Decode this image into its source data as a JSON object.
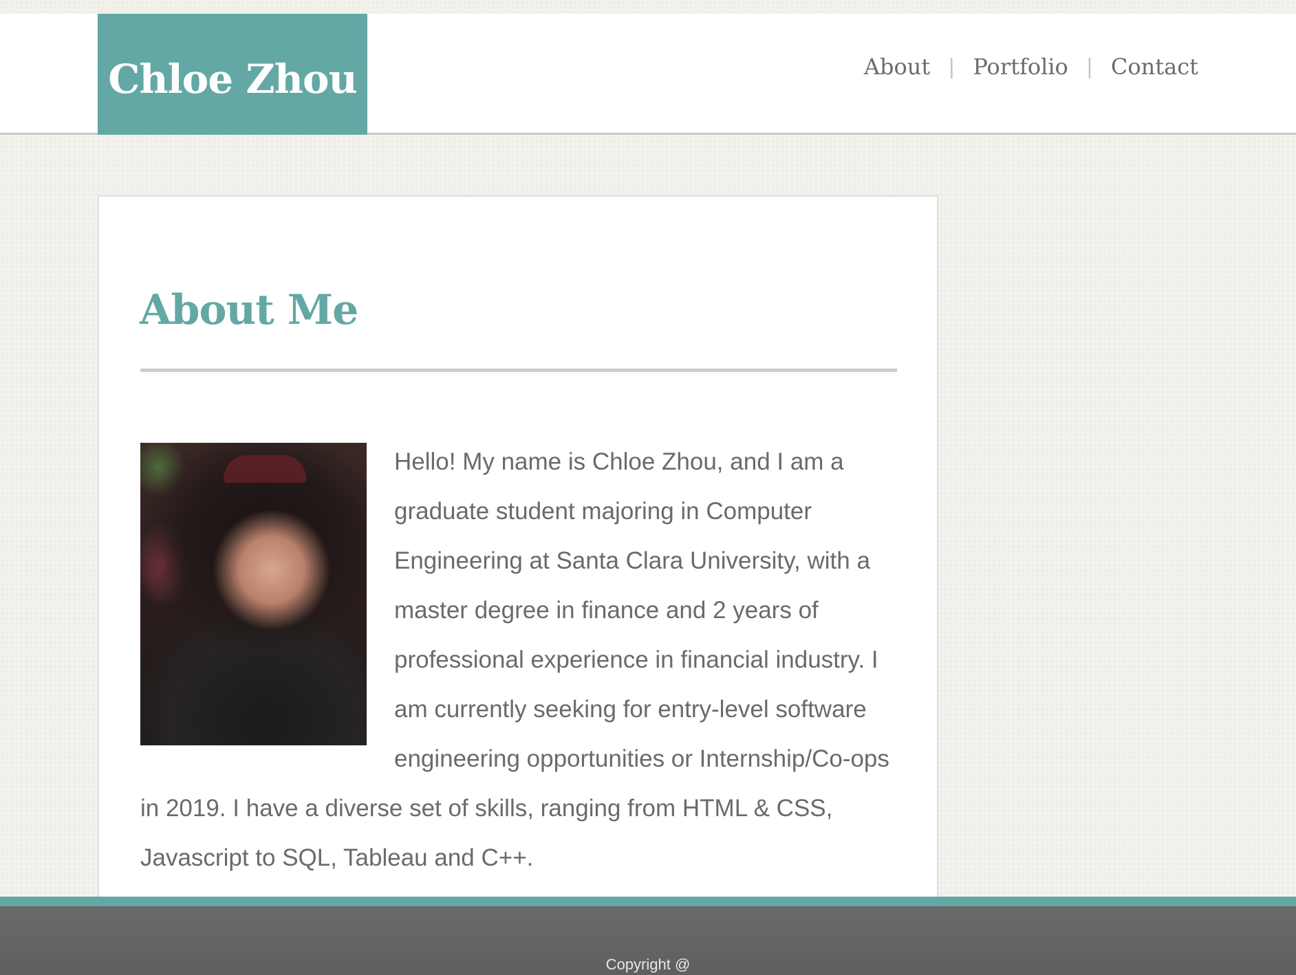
{
  "site": {
    "logo_text": "Chloe Zhou"
  },
  "nav": {
    "items": [
      {
        "label": "About"
      },
      {
        "label": "Portfolio"
      },
      {
        "label": "Contact"
      }
    ],
    "separator": "|"
  },
  "main": {
    "title": "About Me",
    "photo_alt": "Photo of Chloe Zhou",
    "bio": "Hello! My name is Chloe Zhou, and I am a graduate student majoring in Computer Engineering at Santa Clara University, with a master degree in finance and 2 years of professional experience in financial industry. I am currently seeking for entry-level software engineering opportunities or Internship/Co-ops in 2019. I have a diverse set of skills, ranging from HTML & CSS, Javascript to SQL, Tableau and C++."
  },
  "footer": {
    "copyright": "Copyright @"
  },
  "colors": {
    "accent": "#63a8a5",
    "text": "#6a6a6a",
    "footer": "#666666",
    "background": "#f2f0ea"
  }
}
